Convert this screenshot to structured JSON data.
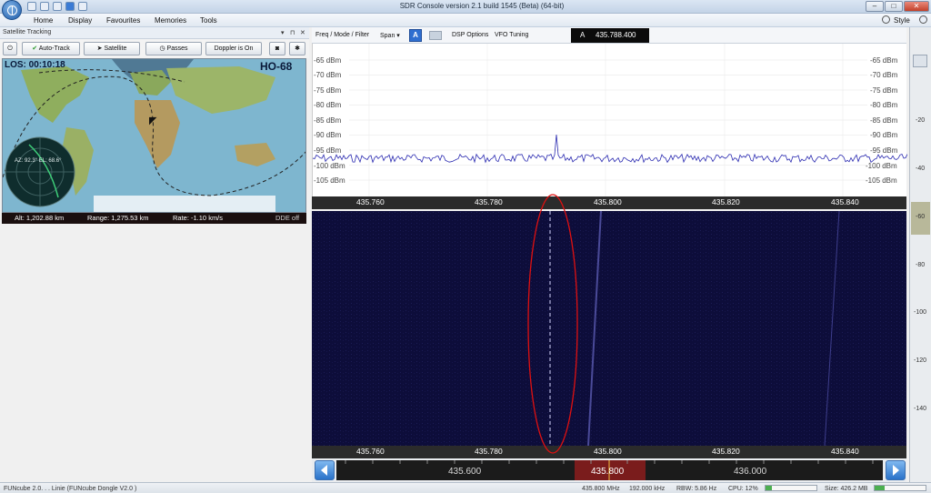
{
  "window": {
    "title": "SDR Console version 2.1 build 1545 (Beta) (64-bit)"
  },
  "menu": {
    "items": [
      "Home",
      "Display",
      "Favourites",
      "Memories",
      "Tools"
    ],
    "style_label": "Style"
  },
  "sat_panel": {
    "title": "Satellite Tracking",
    "toolbar": {
      "auto_track": "Auto-Track",
      "satellite": "Satellite",
      "passes": "Passes",
      "doppler": "Doppler is On"
    },
    "map": {
      "los": "LOS: 00:10:18",
      "sat_name": "HO-68",
      "az_el": "AZ: 92.3°  EL: 68.6°"
    },
    "status": {
      "alt": "Alt: 1,202.88 km",
      "range": "Range: 1,275.53 km",
      "rate": "Rate: -1.10 km/s",
      "dde": "DDE off"
    }
  },
  "spectrum": {
    "toolbar": {
      "freq_mode": "Freq / Mode / Filter",
      "span": "Span",
      "a_button": "A",
      "dsp": "DSP Options",
      "vfo": "VFO Tuning"
    },
    "vfo": {
      "label": "A",
      "frequency": "435.788.400"
    },
    "db_labels": [
      "-65 dBm",
      "-70 dBm",
      "-75 dBm",
      "-80 dBm",
      "-85 dBm",
      "-90 dBm",
      "-95 dBm",
      "-100 dBm",
      "-105 dBm"
    ],
    "freq_ticks": [
      "435.760",
      "435.780",
      "435.800",
      "435.820",
      "435.840"
    ],
    "side_scale": [
      "-20",
      "-40",
      "-60",
      "-80",
      "-100",
      "-120",
      "-140"
    ]
  },
  "tuner": {
    "labels": [
      "435.600",
      "435.800",
      "436.000"
    ]
  },
  "statusbar": {
    "device": "FUNcube 2.0. . . Linie (FUNcube Dongle V2.0 )",
    "freq": "435.800 MHz",
    "bw": "192.000 kHz",
    "rbw": "RBW: 5.86 Hz",
    "cpu": "CPU: 12%",
    "size": "Size: 426.2 MB"
  },
  "colors": {
    "waterfall_bg": "#0d0d3a",
    "trace": "#2a2ab0",
    "highlight": "#e01010"
  }
}
